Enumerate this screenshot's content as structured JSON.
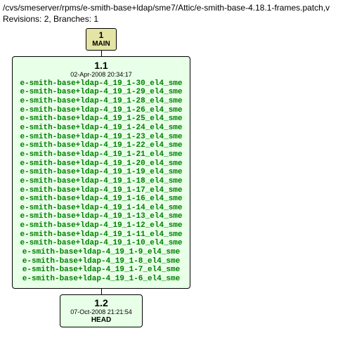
{
  "header": {
    "path": "/cvs/smeserver/rpms/e-smith-base+ldap/sme7/Attic/e-smith-base-4.18.1-frames.patch,v",
    "stats": "Revisions: 2, Branches: 1"
  },
  "branch": {
    "num": "1",
    "name": "MAIN"
  },
  "rev1": {
    "title": "1.1",
    "date": "02-Apr-2008 20:34:17",
    "tags": [
      "e-smith-base+ldap-4_19_1-30_el4_sme",
      "e-smith-base+ldap-4_19_1-29_el4_sme",
      "e-smith-base+ldap-4_19_1-28_el4_sme",
      "e-smith-base+ldap-4_19_1-26_el4_sme",
      "e-smith-base+ldap-4_19_1-25_el4_sme",
      "e-smith-base+ldap-4_19_1-24_el4_sme",
      "e-smith-base+ldap-4_19_1-23_el4_sme",
      "e-smith-base+ldap-4_19_1-22_el4_sme",
      "e-smith-base+ldap-4_19_1-21_el4_sme",
      "e-smith-base+ldap-4_19_1-20_el4_sme",
      "e-smith-base+ldap-4_19_1-19_el4_sme",
      "e-smith-base+ldap-4_19_1-18_el4_sme",
      "e-smith-base+ldap-4_19_1-17_el4_sme",
      "e-smith-base+ldap-4_19_1-16_el4_sme",
      "e-smith-base+ldap-4_19_1-14_el4_sme",
      "e-smith-base+ldap-4_19_1-13_el4_sme",
      "e-smith-base+ldap-4_19_1-12_el4_sme",
      "e-smith-base+ldap-4_19_1-11_el4_sme",
      "e-smith-base+ldap-4_19_1-10_el4_sme",
      "e-smith-base+ldap-4_19_1-9_el4_sme",
      "e-smith-base+ldap-4_19_1-8_el4_sme",
      "e-smith-base+ldap-4_19_1-7_el4_sme",
      "e-smith-base+ldap-4_19_1-6_el4_sme"
    ]
  },
  "rev2": {
    "title": "1.2",
    "date": "07-Oct-2008 21:21:54",
    "head": "HEAD"
  }
}
